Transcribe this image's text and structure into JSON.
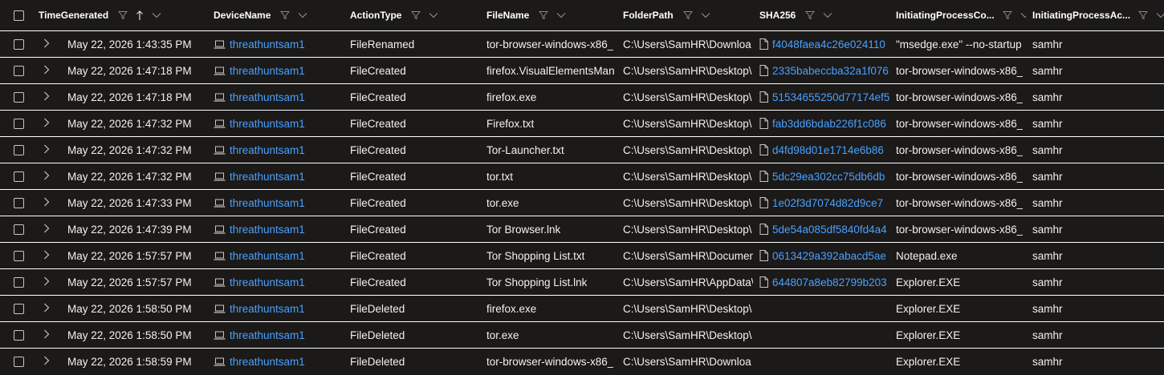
{
  "columns": {
    "time": "TimeGenerated",
    "device": "DeviceName",
    "action": "ActionType",
    "file": "FileName",
    "folder": "FolderPath",
    "sha": "SHA256",
    "cmd": "InitiatingProcessCo...",
    "acct": "InitiatingProcessAc..."
  },
  "sort": {
    "column": "TimeGenerated",
    "direction": "ascending"
  },
  "rows": [
    {
      "time": "May 22, 2026 1:43:35 PM",
      "device": "threathuntsam1",
      "action": "FileRenamed",
      "file": "tor-browser-windows-x86_",
      "folder": "C:\\Users\\SamHR\\Downloa",
      "sha": "f4048faea4c26e024110",
      "cmd": "\"msedge.exe\" --no-startup",
      "acct": "samhr"
    },
    {
      "time": "May 22, 2026 1:47:18 PM",
      "device": "threathuntsam1",
      "action": "FileCreated",
      "file": "firefox.VisualElementsMan",
      "folder": "C:\\Users\\SamHR\\Desktop\\",
      "sha": "2335babeccba32a1f076",
      "cmd": "tor-browser-windows-x86_",
      "acct": "samhr"
    },
    {
      "time": "May 22, 2026 1:47:18 PM",
      "device": "threathuntsam1",
      "action": "FileCreated",
      "file": "firefox.exe",
      "folder": "C:\\Users\\SamHR\\Desktop\\",
      "sha": "51534655250d77174ef5",
      "cmd": "tor-browser-windows-x86_",
      "acct": "samhr"
    },
    {
      "time": "May 22, 2026 1:47:32 PM",
      "device": "threathuntsam1",
      "action": "FileCreated",
      "file": "Firefox.txt",
      "folder": "C:\\Users\\SamHR\\Desktop\\",
      "sha": "fab3dd6bdab226f1c086",
      "cmd": "tor-browser-windows-x86_",
      "acct": "samhr"
    },
    {
      "time": "May 22, 2026 1:47:32 PM",
      "device": "threathuntsam1",
      "action": "FileCreated",
      "file": "Tor-Launcher.txt",
      "folder": "C:\\Users\\SamHR\\Desktop\\",
      "sha": "d4fd98d01e1714e6b86",
      "cmd": "tor-browser-windows-x86_",
      "acct": "samhr"
    },
    {
      "time": "May 22, 2026 1:47:32 PM",
      "device": "threathuntsam1",
      "action": "FileCreated",
      "file": "tor.txt",
      "folder": "C:\\Users\\SamHR\\Desktop\\",
      "sha": "5dc29ea302cc75db6db",
      "cmd": "tor-browser-windows-x86_",
      "acct": "samhr"
    },
    {
      "time": "May 22, 2026 1:47:33 PM",
      "device": "threathuntsam1",
      "action": "FileCreated",
      "file": "tor.exe",
      "folder": "C:\\Users\\SamHR\\Desktop\\",
      "sha": "1e02f3d7074d82d9ce7",
      "cmd": "tor-browser-windows-x86_",
      "acct": "samhr"
    },
    {
      "time": "May 22, 2026 1:47:39 PM",
      "device": "threathuntsam1",
      "action": "FileCreated",
      "file": "Tor Browser.lnk",
      "folder": "C:\\Users\\SamHR\\Desktop\\",
      "sha": "5de54a085df5840fd4a4",
      "cmd": "tor-browser-windows-x86_",
      "acct": "samhr"
    },
    {
      "time": "May 22, 2026 1:57:57 PM",
      "device": "threathuntsam1",
      "action": "FileCreated",
      "file": "Tor Shopping List.txt",
      "folder": "C:\\Users\\SamHR\\Documen",
      "sha": "0613429a392abacd5ae",
      "cmd": "Notepad.exe",
      "acct": "samhr"
    },
    {
      "time": "May 22, 2026 1:57:57 PM",
      "device": "threathuntsam1",
      "action": "FileCreated",
      "file": "Tor Shopping List.lnk",
      "folder": "C:\\Users\\SamHR\\AppData\\",
      "sha": "644807a8eb82799b203",
      "cmd": "Explorer.EXE",
      "acct": "samhr"
    },
    {
      "time": "May 22, 2026 1:58:50 PM",
      "device": "threathuntsam1",
      "action": "FileDeleted",
      "file": "firefox.exe",
      "folder": "C:\\Users\\SamHR\\Desktop\\",
      "sha": "",
      "cmd": "Explorer.EXE",
      "acct": "samhr"
    },
    {
      "time": "May 22, 2026 1:58:50 PM",
      "device": "threathuntsam1",
      "action": "FileDeleted",
      "file": "tor.exe",
      "folder": "C:\\Users\\SamHR\\Desktop\\",
      "sha": "",
      "cmd": "Explorer.EXE",
      "acct": "samhr"
    },
    {
      "time": "May 22, 2026 1:58:59 PM",
      "device": "threathuntsam1",
      "action": "FileDeleted",
      "file": "tor-browser-windows-x86_",
      "folder": "C:\\Users\\SamHR\\Downloa",
      "sha": "",
      "cmd": "Explorer.EXE",
      "acct": "samhr"
    }
  ],
  "colors": {
    "background": "#1b1a19",
    "link": "#4aa0ff",
    "divider": "#ffffff"
  }
}
